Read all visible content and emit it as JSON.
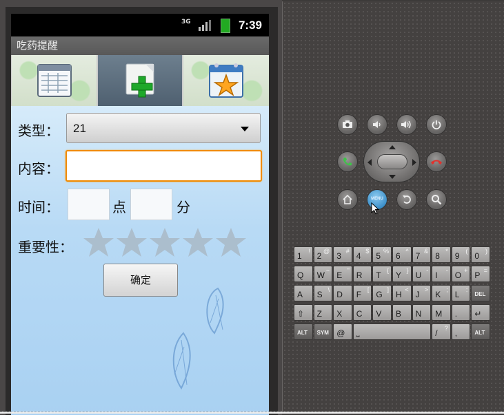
{
  "status_bar": {
    "network": "3G",
    "time": "7:39"
  },
  "app": {
    "title": "吃药提醒"
  },
  "tabs": [
    {
      "icon": "calendar-list-icon",
      "selected": false
    },
    {
      "icon": "add-document-icon",
      "selected": true
    },
    {
      "icon": "favorite-calendar-icon",
      "selected": false
    }
  ],
  "form": {
    "type_label": "类型：",
    "type_value": "21",
    "content_label": "内容：",
    "content_value": "",
    "time_label": "时间：",
    "hour_value": "",
    "hour_unit": "点",
    "minute_value": "",
    "minute_unit": "分",
    "importance_label": "重要性：",
    "importance_rating": 0,
    "importance_max": 5,
    "confirm_label": "确定"
  },
  "emulator_controls": {
    "buttons": [
      "camera-icon",
      "volume-down-icon",
      "volume-up-icon",
      "power-icon",
      "call-icon",
      "end-call-icon",
      "home-icon",
      "menu-icon",
      "back-icon",
      "search-icon"
    ],
    "menu_label": "MENU"
  },
  "keyboard": {
    "rows": [
      [
        {
          "m": "1",
          "s": "!"
        },
        {
          "m": "2",
          "s": "@"
        },
        {
          "m": "3",
          "s": "#"
        },
        {
          "m": "4",
          "s": "$"
        },
        {
          "m": "5",
          "s": "%"
        },
        {
          "m": "6",
          "s": "^"
        },
        {
          "m": "7",
          "s": "&"
        },
        {
          "m": "8",
          "s": "*"
        },
        {
          "m": "9",
          "s": "("
        },
        {
          "m": "0",
          "s": ")"
        }
      ],
      [
        {
          "m": "Q",
          "s": ""
        },
        {
          "m": "W",
          "s": "~"
        },
        {
          "m": "E",
          "s": "\""
        },
        {
          "m": "R",
          "s": ""
        },
        {
          "m": "T",
          "s": "{"
        },
        {
          "m": "Y",
          "s": "}"
        },
        {
          "m": "U",
          "s": "-"
        },
        {
          "m": "I",
          "s": "-"
        },
        {
          "m": "O",
          "s": "+"
        },
        {
          "m": "P",
          "s": "="
        }
      ],
      [
        {
          "m": "A",
          "s": ""
        },
        {
          "m": "S",
          "s": "\\"
        },
        {
          "m": "D",
          "s": ""
        },
        {
          "m": "F",
          "s": "["
        },
        {
          "m": "G",
          "s": "]"
        },
        {
          "m": "H",
          "s": "<"
        },
        {
          "m": "J",
          "s": ">"
        },
        {
          "m": "K",
          "s": ";"
        },
        {
          "m": "L",
          "s": ":"
        },
        {
          "m": "DEL",
          "s": ""
        }
      ],
      [
        {
          "m": "⇧",
          "s": ""
        },
        {
          "m": "Z",
          "s": ""
        },
        {
          "m": "X",
          "s": ""
        },
        {
          "m": "C",
          "s": ""
        },
        {
          "m": "V",
          "s": ""
        },
        {
          "m": "B",
          "s": ""
        },
        {
          "m": "N",
          "s": ""
        },
        {
          "m": "M",
          "s": ""
        },
        {
          "m": ".",
          "s": ""
        },
        {
          "m": "↵",
          "s": ""
        }
      ],
      [
        {
          "m": "ALT",
          "s": ""
        },
        {
          "m": "SYM",
          "s": ""
        },
        {
          "m": "@",
          "s": ""
        },
        {
          "m": "⎵",
          "s": ""
        },
        {
          "m": "/",
          "s": "?"
        },
        {
          "m": ",",
          "s": ""
        },
        {
          "m": "ALT",
          "s": ""
        }
      ]
    ]
  }
}
